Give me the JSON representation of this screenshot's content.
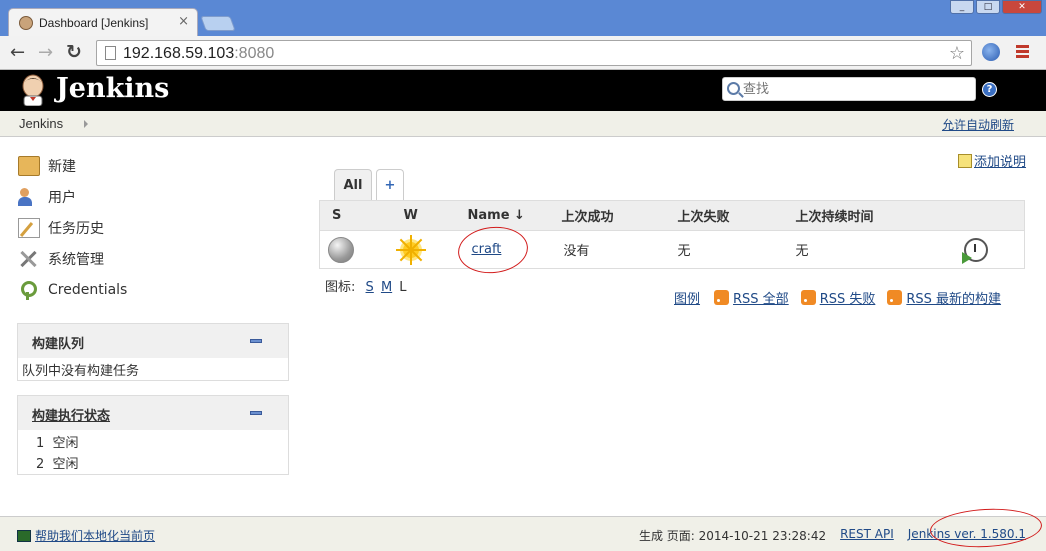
{
  "browser": {
    "tab_title": "Dashboard [Jenkins]",
    "tab_close": "×",
    "url_host": "192.168.59.103",
    "url_port": ":8080",
    "win_min": "_",
    "win_max": "□",
    "win_close": "✕"
  },
  "header": {
    "logo_text": "Jenkins",
    "search_placeholder": "查找",
    "help": "?"
  },
  "breadcrumb": {
    "root": "Jenkins",
    "auto_refresh": "允许自动刷新"
  },
  "sidebar": {
    "items": [
      {
        "label": "新建",
        "icon": "new-item-icon"
      },
      {
        "label": "用户",
        "icon": "users-icon"
      },
      {
        "label": "任务历史",
        "icon": "build-history-icon"
      },
      {
        "label": "系统管理",
        "icon": "manage-tools-icon"
      },
      {
        "label": "Credentials",
        "icon": "credentials-icon"
      }
    ]
  },
  "build_queue": {
    "title": "构建队列",
    "empty_text": "队列中没有构建任务"
  },
  "executor_status": {
    "title": "构建执行状态",
    "executors": [
      {
        "num": "1",
        "status": "空闲"
      },
      {
        "num": "2",
        "status": "空闲"
      }
    ]
  },
  "main": {
    "add_description": "添加说明",
    "view_tabs": [
      "All",
      "+"
    ],
    "table": {
      "headers": [
        "S",
        "W",
        "Name ↓",
        "上次成功",
        "上次失败",
        "上次持续时间"
      ],
      "rows": [
        {
          "name": "craft",
          "last_success": "没有",
          "last_failure": "无",
          "last_duration": "无"
        }
      ]
    },
    "icon_size_label": "图标:",
    "icon_sizes": [
      "S",
      "M",
      "L"
    ],
    "legend": "图例",
    "rss_all": "RSS 全部",
    "rss_failed": "RSS 失败",
    "rss_latest": "RSS 最新的构建"
  },
  "footer": {
    "help_localize": "帮助我们本地化当前页",
    "generated": "生成 页面: 2014-10-21 23:28:42",
    "rest_api": "REST API",
    "version": "Jenkins ver. 1.580.1"
  },
  "colors": {
    "tabbar": "#5a88d4",
    "header_bg": "#000000",
    "link": "#204a87",
    "annotation": "#d21b1b"
  }
}
